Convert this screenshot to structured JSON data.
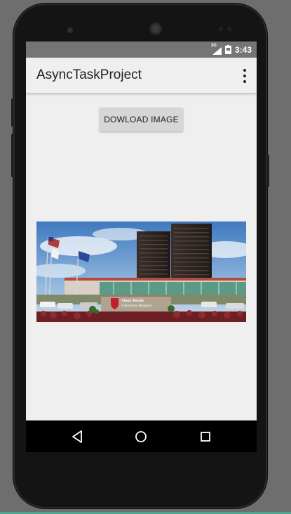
{
  "status_bar": {
    "network": "3G",
    "time": "3:43"
  },
  "app_bar": {
    "title": "AsyncTaskProject",
    "overflow_icon": "more-vert-icon"
  },
  "main": {
    "download_button_label": "DOWLOAD IMAGE",
    "image": {
      "sign_line1": "Stony Brook",
      "sign_line2": "University Hospital"
    }
  },
  "nav_bar": {
    "icons": [
      "back-icon",
      "home-icon",
      "recents-icon"
    ]
  }
}
